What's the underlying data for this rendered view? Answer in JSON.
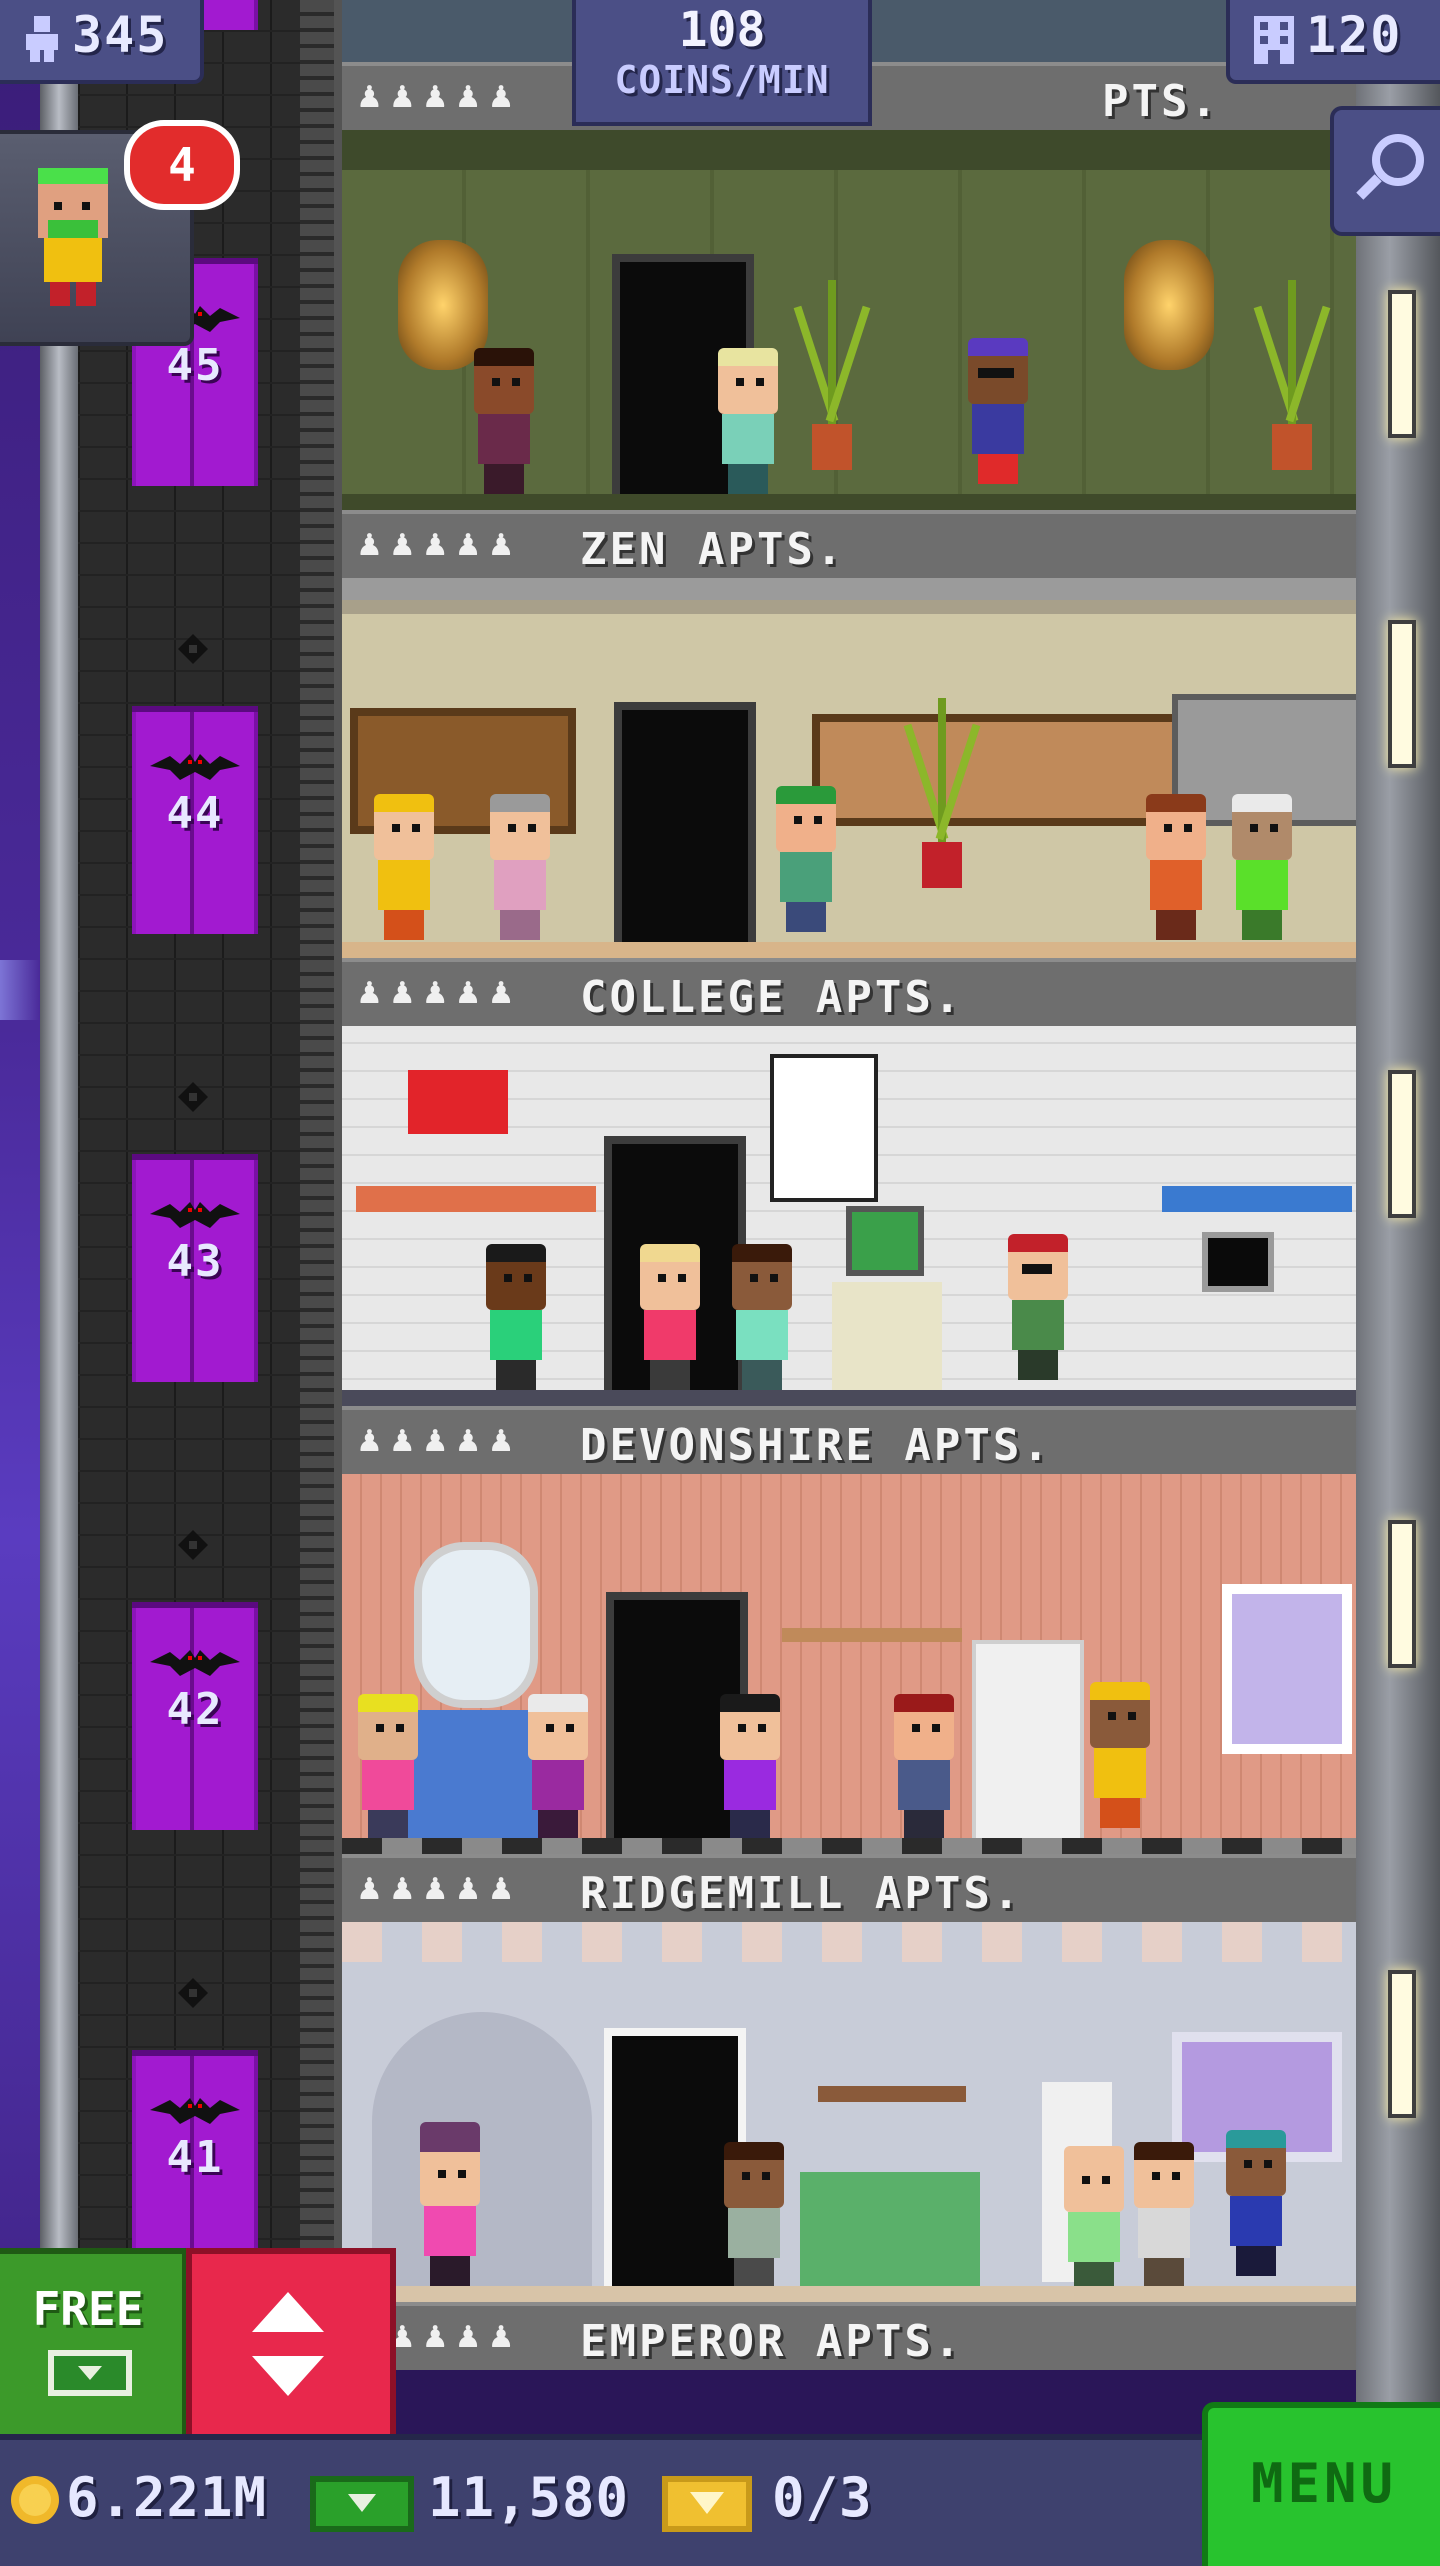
{
  "hud": {
    "population": "345",
    "coins_per_min_value": "108",
    "coins_per_min_unit": "COINS/MIN",
    "floors": "120",
    "visitor_badge": "4"
  },
  "top_floor": {
    "name": "PTS.",
    "persons": "♟♟♟♟♟"
  },
  "floors": [
    {
      "number": "45",
      "name": "ZEN APTS.",
      "persons": "♟♟♟♟♟"
    },
    {
      "number": "44",
      "name": "COLLEGE APTS.",
      "persons": "♟♟♟♟♟"
    },
    {
      "number": "43",
      "name": "DEVONSHIRE APTS.",
      "persons": "♟♟♟♟♟"
    },
    {
      "number": "42",
      "name": "RIDGEMILL APTS.",
      "persons": "♟♟♟♟♟"
    },
    {
      "number": "41",
      "name": "EMPEROR APTS.",
      "persons": "♟♟♟♟♟"
    }
  ],
  "buttons": {
    "free_label": "FREE",
    "menu_label": "MENU"
  },
  "bottom_bar": {
    "coins": "6.221M",
    "bux": "11,580",
    "tickets": "0/3"
  },
  "icons": {
    "population": "person-icon",
    "floors": "building-icon",
    "search": "magnifier-icon",
    "elevator": "up-down-arrows-icon",
    "coins": "coin-icon",
    "bux": "bux-icon",
    "tickets": "ticket-icon"
  },
  "colors": {
    "elevator_door": "#a21ad0",
    "free_button": "#3c9a2a",
    "elevator_button": "#e8284c",
    "menu_button": "#28c32e",
    "hud": "#4b4f86"
  }
}
